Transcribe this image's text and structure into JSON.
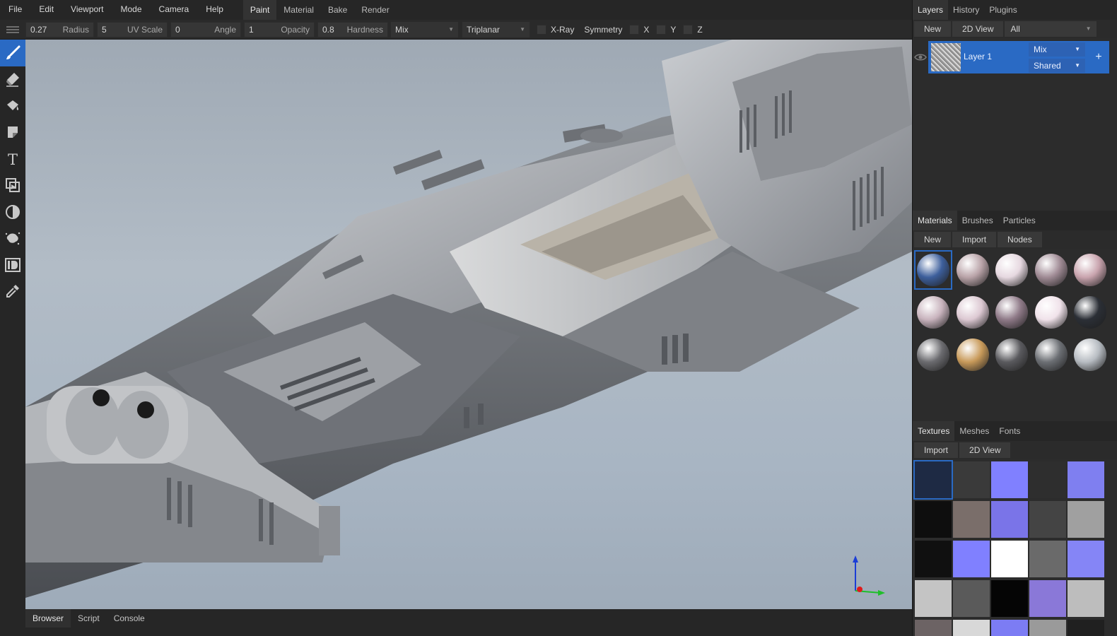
{
  "menu": [
    "File",
    "Edit",
    "Viewport",
    "Mode",
    "Camera",
    "Help"
  ],
  "workspace_tabs": [
    {
      "label": "Paint",
      "active": true
    },
    {
      "label": "Material",
      "active": false
    },
    {
      "label": "Bake",
      "active": false
    },
    {
      "label": "Render",
      "active": false
    }
  ],
  "toolbar": {
    "radius": {
      "value": "0.27",
      "label": "Radius"
    },
    "uv_scale": {
      "value": "5",
      "label": "UV Scale"
    },
    "angle": {
      "value": "0",
      "label": "Angle"
    },
    "opacity": {
      "value": "1",
      "label": "Opacity"
    },
    "hardness": {
      "value": "0.8",
      "label": "Hardness"
    },
    "blend_mode": "Mix",
    "projection": "Triplanar",
    "xray_label": "X-Ray",
    "symmetry_label": "Symmetry",
    "sym_x": "X",
    "sym_y": "Y",
    "sym_z": "Z"
  },
  "tools": [
    {
      "icon": "brush-icon",
      "active": true
    },
    {
      "icon": "eraser-icon",
      "active": false
    },
    {
      "icon": "fill-bucket-icon",
      "active": false
    },
    {
      "icon": "decal-icon",
      "active": false
    },
    {
      "icon": "text-icon",
      "active": false
    },
    {
      "icon": "clone-icon",
      "active": false
    },
    {
      "icon": "blur-icon",
      "active": false
    },
    {
      "icon": "particle-icon",
      "active": false
    },
    {
      "icon": "colorid-icon",
      "active": false
    },
    {
      "icon": "picker-icon",
      "active": false
    }
  ],
  "bottom_tabs": [
    {
      "label": "Browser",
      "active": true
    },
    {
      "label": "Script",
      "active": false
    },
    {
      "label": "Console",
      "active": false
    }
  ],
  "layers_panel": {
    "tabs": [
      {
        "label": "Layers",
        "active": true
      },
      {
        "label": "History",
        "active": false
      },
      {
        "label": "Plugins",
        "active": false
      }
    ],
    "new_label": "New",
    "view2d_label": "2D View",
    "filter": "All",
    "layer": {
      "name": "Layer 1",
      "blend": "Mix",
      "object": "Shared",
      "add_label": "+"
    }
  },
  "materials_panel": {
    "tabs": [
      {
        "label": "Materials",
        "active": true
      },
      {
        "label": "Brushes",
        "active": false
      },
      {
        "label": "Particles",
        "active": false
      }
    ],
    "buttons": [
      "New",
      "Import",
      "Nodes"
    ],
    "swatches": [
      "#3d5f9c",
      "#b9a3a8",
      "#e6d8e0",
      "#a08b95",
      "#c9a4ae",
      "#c8b3bd",
      "#dcc8d2",
      "#8f7a88",
      "#f0e2ea",
      "#2b2f36",
      "#6b6b6f",
      "#c89a5a",
      "#5a5a5e",
      "#6c6f74",
      "#b7bcc2"
    ]
  },
  "textures_panel": {
    "tabs": [
      {
        "label": "Textures",
        "active": true
      },
      {
        "label": "Meshes",
        "active": false
      },
      {
        "label": "Fonts",
        "active": false
      }
    ],
    "buttons": [
      "Import",
      "2D View"
    ],
    "swatches": [
      "#1e2a44",
      "#3a3a3a",
      "#8080ff",
      "#2e2e2e",
      "#7f7ff0",
      "#0e0e0e",
      "#7a6e6a",
      "#7a74e8",
      "#444444",
      "#a0a0a0",
      "#101010",
      "#8080ff",
      "#ffffff",
      "#6a6a6a",
      "#8585f6",
      "#c4c4c4",
      "#5a5a5a",
      "#050505",
      "#8a78d8",
      "#bdbdbd",
      "#6c6364",
      "#d8d8d8",
      "#7c7cf4",
      "#9a9a9a",
      "#202020"
    ]
  },
  "colors": {
    "accent": "#2a6ac4",
    "panel_bg": "#262626"
  }
}
